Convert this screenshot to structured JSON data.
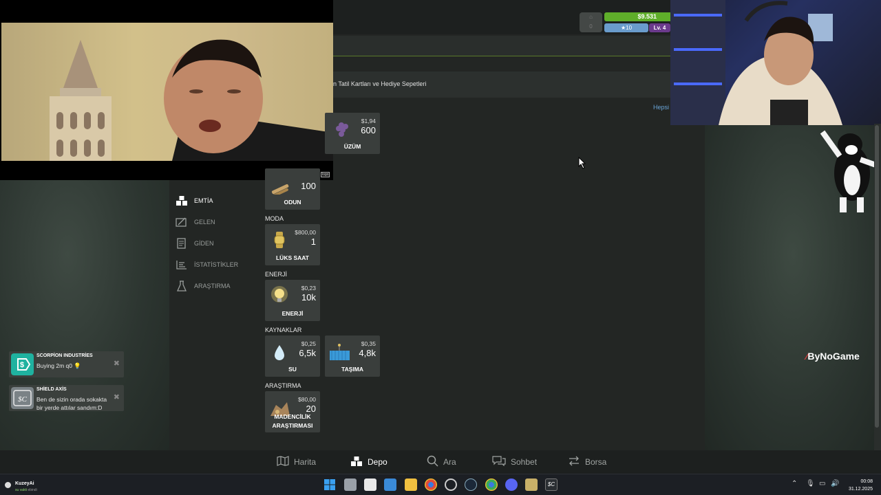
{
  "header": {
    "money": "$9.531",
    "stars": "10",
    "level": "Lv. 4"
  },
  "subtitle": "n Tatil Kartları ve Hediye Sepetleri",
  "view_all": "Hepsi",
  "sidebar": {
    "items": [
      {
        "label": "EMTİA",
        "icon": "boxes-icon",
        "active": true
      },
      {
        "label": "GELEN",
        "icon": "incoming-icon",
        "active": false
      },
      {
        "label": "GİDEN",
        "icon": "outgoing-icon",
        "active": false
      },
      {
        "label": "İSTATİSTİKLER",
        "icon": "stats-icon",
        "active": false
      },
      {
        "label": "ARAŞTIRMA",
        "icon": "flask-icon",
        "active": false
      }
    ]
  },
  "sections": {
    "moda": "MODA",
    "enerji": "ENERJİ",
    "kaynaklar": "KAYNAKLAR",
    "arastirma": "ARAŞTIRMA"
  },
  "cards": {
    "uzum": {
      "price": "$1,94",
      "qty": "600",
      "label": "ÜZÜM"
    },
    "odun": {
      "qty": "100",
      "label": "ODUN"
    },
    "luks_saat": {
      "price": "$800,00",
      "qty": "1",
      "label": "LÜKS SAAT"
    },
    "enerji": {
      "price": "$0,23",
      "qty": "10k",
      "label": "ENERJİ"
    },
    "su": {
      "price": "$0,25",
      "qty": "6,5k",
      "label": "SU"
    },
    "tasima": {
      "price": "$0,35",
      "qty": "4,8k",
      "label": "TAŞIMA"
    },
    "madencilik": {
      "price": "$80,00",
      "qty": "20",
      "label_1": "MADENCİLİK",
      "label_2": "ARAŞTIRMASI"
    }
  },
  "notifications": [
    {
      "title": "SCORPİON INDUSTRİES",
      "text": "Buying 2m q0 💡",
      "icon": "dollar-tag-icon"
    },
    {
      "title": "SHİELD AXİS",
      "text_1": "Ben de sizin orada sokakta",
      "text_2": "bir yerde attılar sandım:D",
      "icon": "sc-logo-icon"
    }
  ],
  "bottom_nav": [
    {
      "label": "Harita",
      "icon": "map-icon"
    },
    {
      "label": "Depo",
      "icon": "boxes-icon",
      "active": true
    },
    {
      "label": "Ara",
      "icon": "search-icon"
    },
    {
      "label": "Sohbet",
      "icon": "chat-icon"
    },
    {
      "label": "Borsa",
      "icon": "exchange-icon"
    }
  ],
  "brand_watermark": "ByNoGame",
  "taskbar": {
    "user": "KuzeyAi",
    "user_status": "su vakti",
    "user_status_suffix": "ebindi",
    "time": "00:08",
    "date": "31.12.2025"
  },
  "colors": {
    "money": "#5fae2a",
    "stars": "#6a9ccc",
    "level": "#6b3a8c",
    "card_bg": "#3a3e3c"
  }
}
